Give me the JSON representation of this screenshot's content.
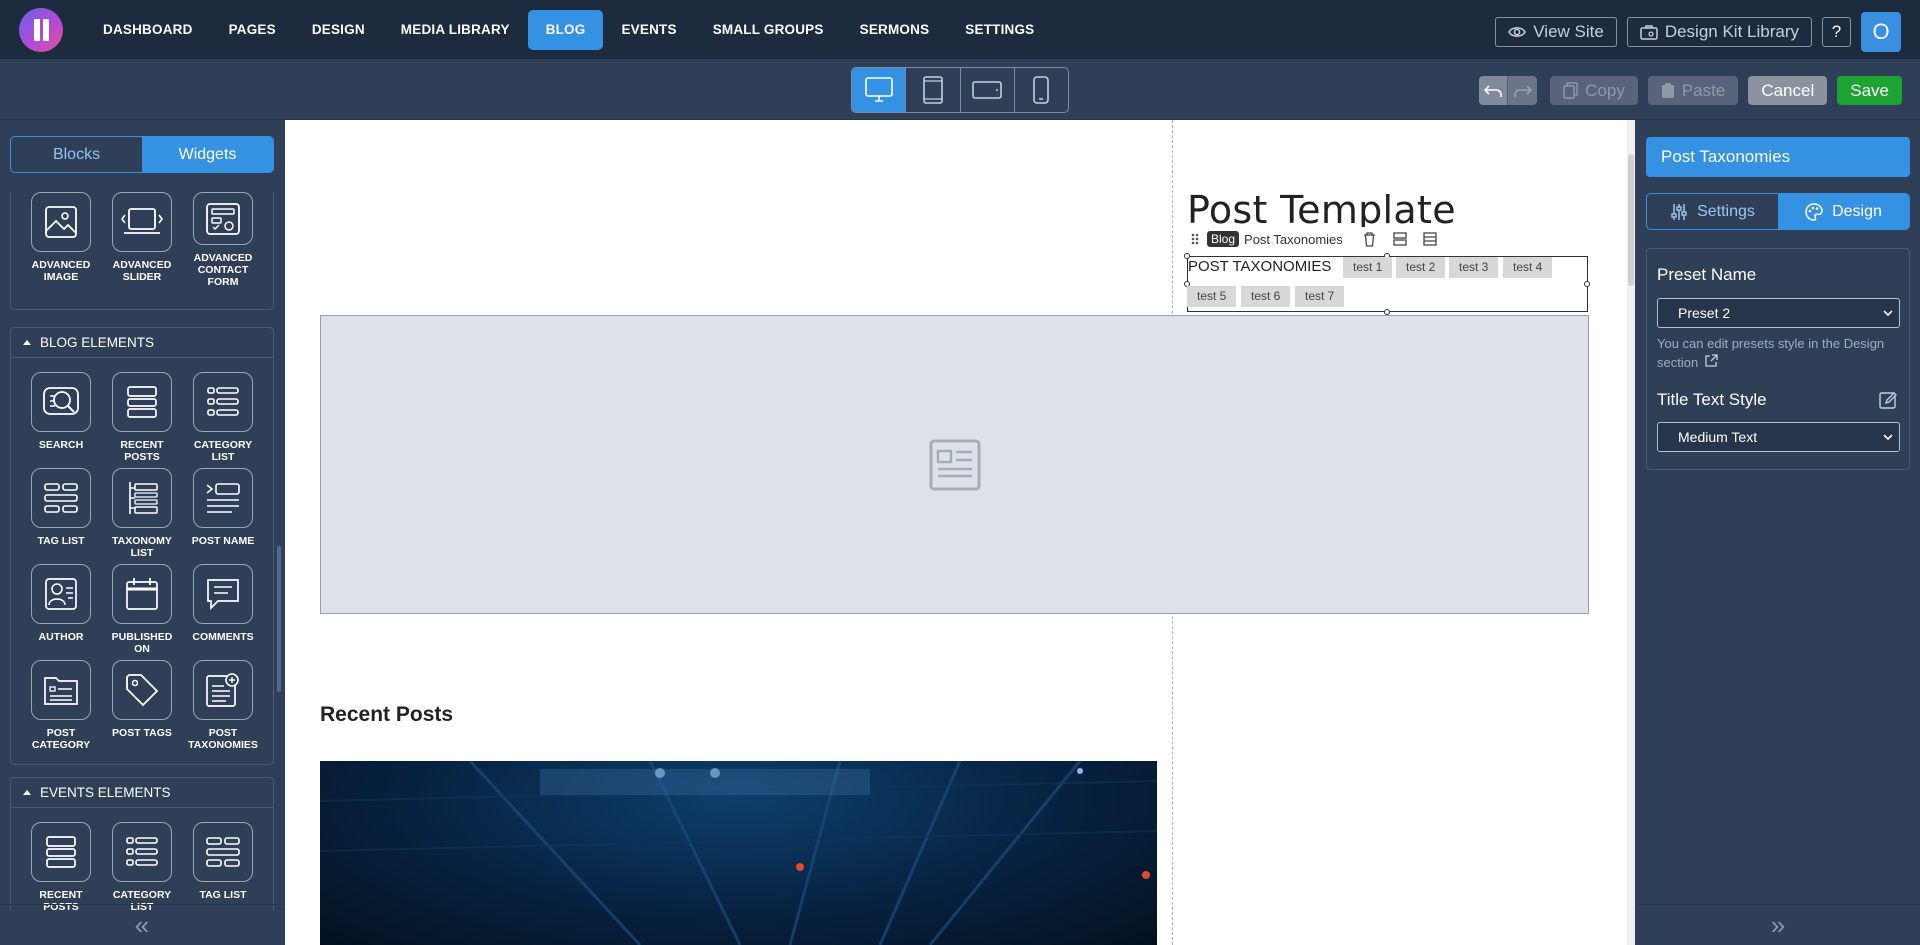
{
  "nav": {
    "items": [
      {
        "label": "DASHBOARD"
      },
      {
        "label": "PAGES"
      },
      {
        "label": "DESIGN"
      },
      {
        "label": "MEDIA LIBRARY"
      },
      {
        "label": "BLOG",
        "active": true
      },
      {
        "label": "EVENTS"
      },
      {
        "label": "SMALL GROUPS"
      },
      {
        "label": "SERMONS"
      },
      {
        "label": "SETTINGS"
      }
    ],
    "view_site": "View Site",
    "design_kit": "Design Kit Library",
    "help": "?",
    "avatar": "O"
  },
  "toolbar": {
    "devices": [
      "desktop-icon",
      "tablet-icon",
      "tablet-landscape-icon",
      "mobile-icon"
    ],
    "active_device": "desktop",
    "copy": "Copy",
    "paste": "Paste",
    "cancel": "Cancel",
    "save": "Save"
  },
  "left_panel": {
    "tabs": {
      "blocks": "Blocks",
      "widgets": "Widgets"
    },
    "active_tab": "Widgets",
    "top_widgets": [
      {
        "label": "ADVANCED IMAGE",
        "icon": "advanced-image-icon"
      },
      {
        "label": "ADVANCED SLIDER",
        "icon": "advanced-slider-icon"
      },
      {
        "label": "ADVANCED CONTACT FORM",
        "icon": "advanced-contact-form-icon"
      }
    ],
    "blog_group": {
      "title": "BLOG ELEMENTS",
      "items": [
        {
          "label": "SEARCH",
          "icon": "search-icon"
        },
        {
          "label": "RECENT POSTS",
          "icon": "recent-posts-icon"
        },
        {
          "label": "CATEGORY LIST",
          "icon": "category-list-icon"
        },
        {
          "label": "TAG LIST",
          "icon": "tag-list-icon"
        },
        {
          "label": "TAXONOMY LIST",
          "icon": "taxonomy-list-icon"
        },
        {
          "label": "POST NAME",
          "icon": "post-name-icon"
        },
        {
          "label": "AUTHOR",
          "icon": "author-icon"
        },
        {
          "label": "PUBLISHED ON",
          "icon": "published-on-icon"
        },
        {
          "label": "COMMENTS",
          "icon": "comments-icon"
        },
        {
          "label": "POST CATEGORY",
          "icon": "post-category-icon"
        },
        {
          "label": "POST TAGS",
          "icon": "post-tags-icon"
        },
        {
          "label": "POST TAXONOMIES",
          "icon": "post-taxonomies-icon"
        }
      ]
    },
    "events_group": {
      "title": "EVENTS ELEMENTS",
      "items": [
        {
          "label": "RECENT POSTS",
          "icon": "recent-posts-icon"
        },
        {
          "label": "CATEGORY LIST",
          "icon": "category-list-icon"
        },
        {
          "label": "TAG LIST",
          "icon": "tag-list-icon"
        }
      ]
    },
    "collapse_icon": "«"
  },
  "canvas": {
    "post_title": "Post Template",
    "breadcrumb": {
      "badge": "Blog",
      "name": "Post Taxonomies"
    },
    "taxonomies_label": "POST TAXONOMIES",
    "tags": [
      "test 1",
      "test 2",
      "test 3",
      "test 4",
      "test 5",
      "test 6",
      "test 7"
    ],
    "recent_posts_heading": "Recent Posts"
  },
  "right_panel": {
    "title": "Post Taxonomies",
    "tabs": {
      "settings": "Settings",
      "design": "Design"
    },
    "active_tab": "Design",
    "preset_label": "Preset Name",
    "preset_value": "Preset 2",
    "preset_help": "You can edit presets style in the Design section",
    "title_text_style_label": "Title Text Style",
    "title_text_style_value": "Medium Text",
    "expand_icon": "»"
  },
  "colors": {
    "accent": "#3591e2",
    "nav_bg": "#1d2b3e",
    "panel_bg": "#2f3f58",
    "save": "#1da332"
  }
}
